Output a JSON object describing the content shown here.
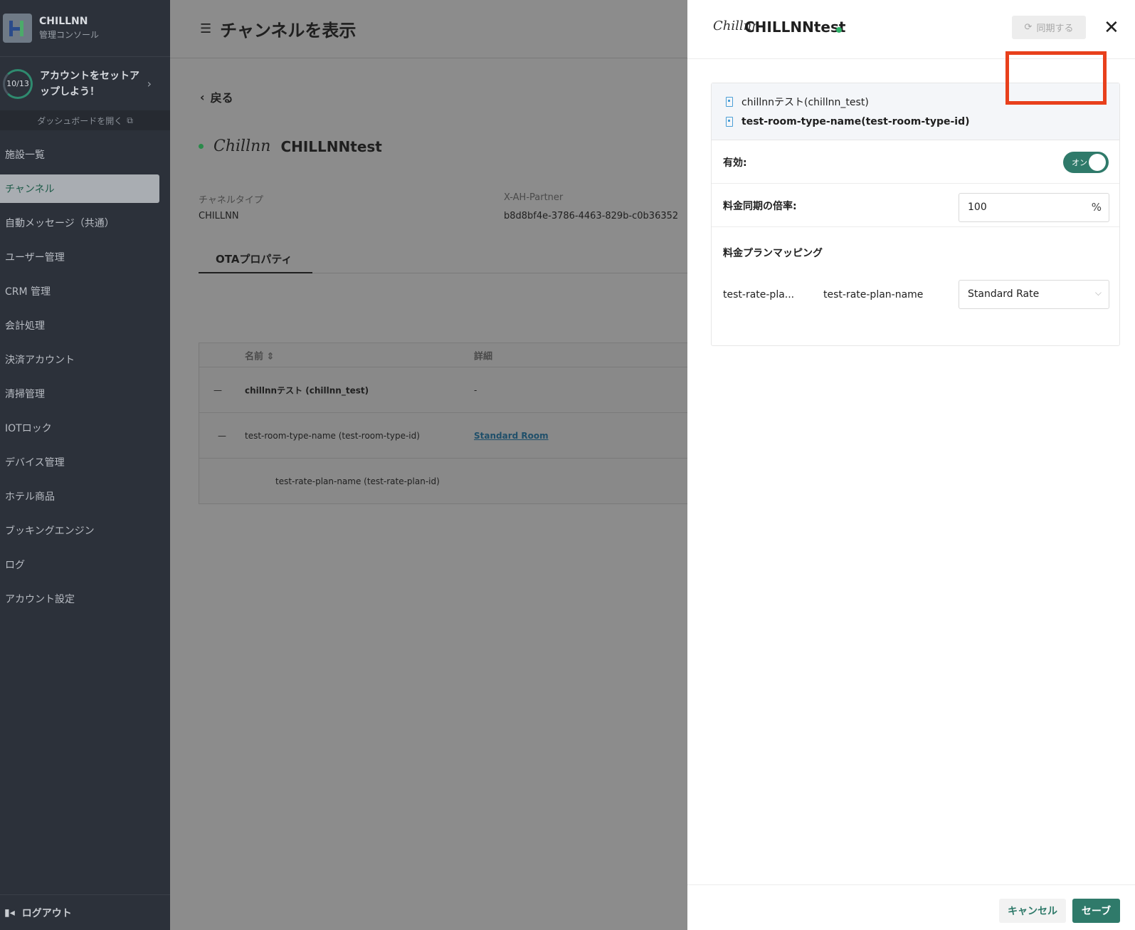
{
  "sidebar": {
    "brand_name": "CHILLNN",
    "brand_sub": "管理コンソール",
    "setup_progress": "10/13",
    "setup_text": "アカウントをセットアップしよう！",
    "dashboard_link": "ダッシュボードを開く",
    "items": [
      {
        "label": "施設一覧"
      },
      {
        "label": "チャンネル"
      },
      {
        "label": "自動メッセージ（共通）"
      },
      {
        "label": "ユーザー管理"
      },
      {
        "label": "CRM 管理"
      },
      {
        "label": "会計処理"
      },
      {
        "label": "決済アカウント"
      },
      {
        "label": "清掃管理"
      },
      {
        "label": "IOTロック"
      },
      {
        "label": "デバイス管理"
      },
      {
        "label": "ホテル商品"
      },
      {
        "label": "ブッキングエンジン"
      },
      {
        "label": "ログ"
      },
      {
        "label": "アカウント設定"
      }
    ],
    "logout": "ログアウト"
  },
  "main": {
    "title": "チャンネルを表示",
    "back": "戻る",
    "channel_logo": "Chillnn",
    "channel_name": "CHILLNNtest",
    "channel_type_label": "チャネルタイプ",
    "channel_type_value": "CHILLNN",
    "partner_label": "X-AH-Partner",
    "partner_value": "b8d8bf4e-3786-4463-829b-c0b36352",
    "tab": "OTAプロパティ",
    "table": {
      "headers": [
        "名前",
        "詳細"
      ],
      "rows": [
        {
          "marker": "—",
          "name": "chillnnテスト (chillnn_test)",
          "detail": "-"
        },
        {
          "marker": "—",
          "name": "test-room-type-name (test-room-type-id)",
          "detail": "Standard Room"
        },
        {
          "marker": "",
          "name": "test-rate-plan-name (test-rate-plan-id)",
          "detail": ""
        }
      ]
    }
  },
  "drawer": {
    "logo": "Chillnn",
    "title": "CHILLNNtest",
    "sync_label": "同期する",
    "property_name": "chillnnテスト(chillnn_test)",
    "room_type": "test-room-type-name(test-room-type-id)",
    "enabled_label": "有効:",
    "toggle_text": "オン",
    "toggle_on": true,
    "rate_label": "料金同期の倍率:",
    "rate_value": "100",
    "rate_suffix": "%",
    "mapping_title": "料金プランマッピング",
    "mapping_id": "test-rate-pla...",
    "mapping_name": "test-rate-plan-name",
    "mapping_select": "Standard Rate",
    "cancel": "キャンセル",
    "save": "セーブ"
  },
  "colors": {
    "accent": "#2f7a6a",
    "highlight": "#e8401c",
    "sidebar_bg": "#2c313a",
    "status_green": "#2fb36a"
  }
}
